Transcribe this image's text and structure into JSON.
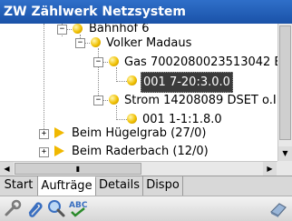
{
  "app": {
    "title": "ZW Zählwerk Netzsystem"
  },
  "tree": {
    "items": [
      {
        "label": "Bahnhof    6",
        "toggle": "−"
      },
      {
        "label": "Volker Madaus",
        "toggle": "−"
      },
      {
        "label": "Gas 7002080023513042 BGZ",
        "toggle": "−"
      },
      {
        "label": "001 7-20:3.0.0",
        "selected": true
      },
      {
        "label": "Strom 14208089 DSET o.IR(",
        "toggle": "−"
      },
      {
        "label": "001 1-1:1.8.0"
      },
      {
        "label": "Beim Hügelgrab (27/0)",
        "toggle": "+"
      },
      {
        "label": "Beim Raderbach (12/0)",
        "toggle": "+"
      }
    ]
  },
  "tabs": [
    "Start",
    "Aufträge",
    "Details",
    "Dispo"
  ],
  "active_tab": "Aufträge",
  "toolbar": {
    "tools": [
      "wrench-icon",
      "clip-icon",
      "magnifier-icon",
      "spellcheck-icon"
    ],
    "spell_label": "ABC",
    "right_tool": "eraser-icon"
  },
  "colors": {
    "title_bar": "#1a52a8",
    "selection": "#3b3b3b",
    "node_dot": "#f0c000"
  }
}
